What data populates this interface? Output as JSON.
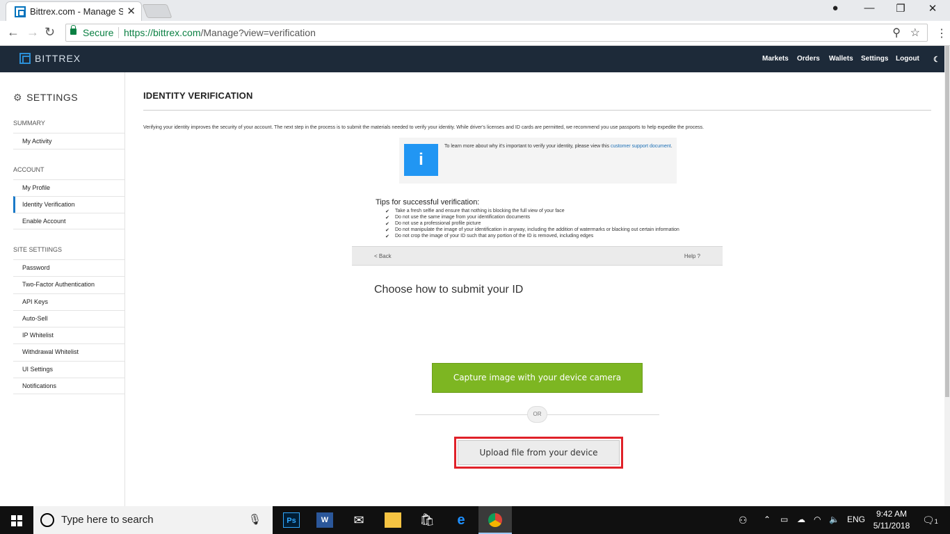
{
  "browser": {
    "tab_title": "Bittrex.com - Manage Set",
    "tab_close": "✕",
    "secure_label": "Secure",
    "url_host": "https://bittrex.com",
    "url_path": "/Manage?view=verification"
  },
  "site": {
    "brand": "BITTREX",
    "nav": [
      "Markets",
      "Orders",
      "Wallets",
      "Settings",
      "Logout"
    ],
    "nightmode_icon": "☾"
  },
  "sidebar": {
    "header": "SETTINGS",
    "sections": [
      {
        "title": "SUMMARY",
        "items": [
          "My Activity"
        ]
      },
      {
        "title": "ACCOUNT",
        "items": [
          "My Profile",
          "Identity Verification",
          "Enable Account"
        ]
      },
      {
        "title": "SITE SETTIINGS",
        "items": [
          "Password",
          "Two-Factor Authentication",
          "API Keys",
          "Auto-Sell",
          "IP Whitelist",
          "Withdrawal Whitelist",
          "UI Settings",
          "Notifications"
        ]
      }
    ],
    "active_item": "Identity Verification"
  },
  "main": {
    "title": "IDENTITY VERIFICATION",
    "intro": "Verifying your identity improves the security of your account. The next step in the process is to submit the materials needed to verify your identity. While driver's licenses and ID cards are permitted, we recommend you use passports to help expedite the process.",
    "info_icon": "i",
    "info_text": "To learn more about why it's important to verify your identity, please view this ",
    "info_link": "customer support document",
    "info_end": ".",
    "tips_header": "Tips for successful verification:",
    "tips": [
      "Take a fresh selfie and ensure that nothing is blocking the full view of your face",
      "Do not use the same image from your identification documents",
      "Do not use a professional profile picture",
      "Do not manipulate the image of your identification in anyway, including the addition of watermarks or blacking out certain information",
      "Do not crop the image of your ID such that any portion of the ID is removed, including edges"
    ],
    "back": "< Back",
    "help": "Help ?",
    "choose": "Choose how to submit your ID",
    "capture": "Capture image with your device camera",
    "or": "OR",
    "upload": "Upload file from your device"
  },
  "taskbar": {
    "search_placeholder": "Type here to search",
    "apps": [
      "Ps",
      "W",
      "mail",
      "explorer",
      "store",
      "edge",
      "chrome"
    ],
    "lang": "ENG",
    "time": "9:42 AM",
    "date": "5/11/2018",
    "notif_count": "1"
  },
  "colors": {
    "header_bg": "#1d2a39",
    "accent": "#1b7ac8",
    "capture_green": "#7db622",
    "highlight_red": "#e02129"
  }
}
